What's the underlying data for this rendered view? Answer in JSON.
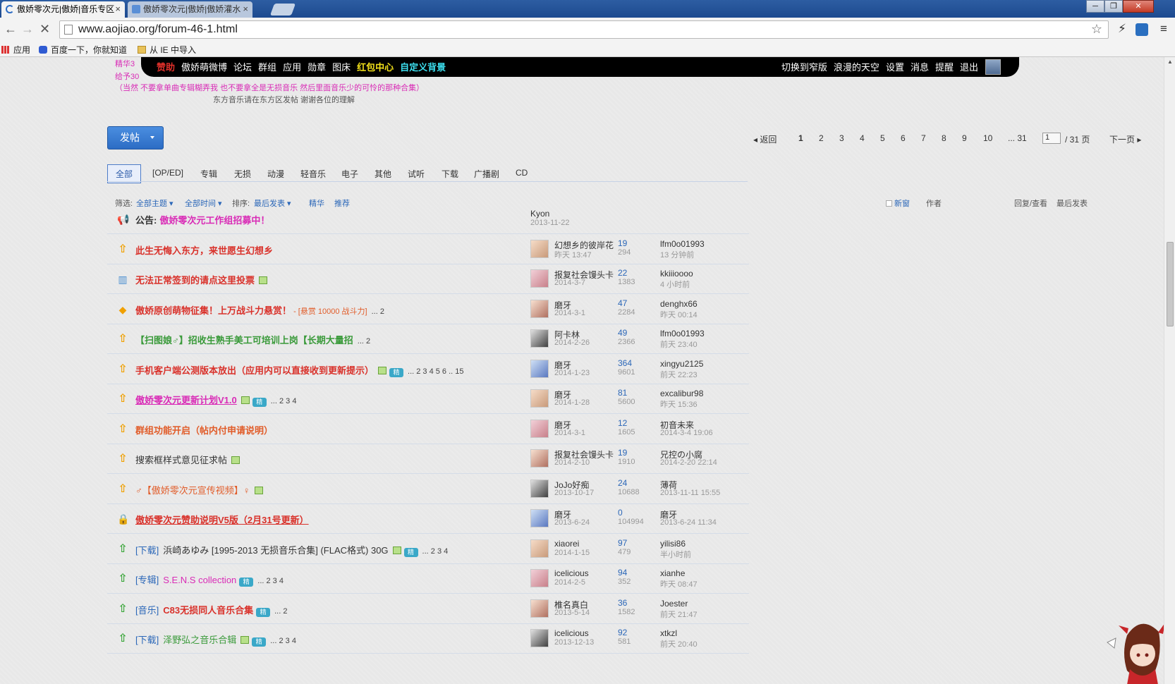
{
  "browser": {
    "tabs": [
      {
        "label": "傲娇零次元|傲娇|音乐专区"
      },
      {
        "label": "傲娇零次元|傲娇|傲娇灌水"
      }
    ],
    "url": "www.aojiao.org/forum-46-1.html",
    "window_controls": [
      "─",
      "❐",
      "✕"
    ],
    "bookmarks": [
      "应用",
      "百度一下，你就知道",
      "从 IE 中导入"
    ]
  },
  "topbar": {
    "left": [
      "赞助",
      "傲娇萌微博",
      "论坛",
      "群组",
      "应用",
      "勋章",
      "图床",
      "红包中心",
      "自定义背景"
    ],
    "right": [
      "切换到窄版",
      "浪漫的天空",
      "设置",
      "消息",
      "提醒",
      "退出"
    ]
  },
  "notices": {
    "line1": "精华3",
    "line2": "给予30",
    "line3": "（当然 不要拿单曲专辑糊弄我 也不要拿全是无损音乐 然后里面音乐少的可怜的那种合集）",
    "line4": "东方音乐请在东方区发帖 谢谢各位的理解"
  },
  "post_button": {
    "label": "发帖"
  },
  "pager": {
    "back": "返回",
    "pages": [
      "1",
      "2",
      "3",
      "4",
      "5",
      "6",
      "7",
      "8",
      "9",
      "10",
      "... 31"
    ],
    "current": "1",
    "input_value": "1",
    "total": "/ 31 页",
    "next": "下一页"
  },
  "type_tabs": [
    "全部",
    "[OP/ED]",
    "专辑",
    "无损",
    "动漫",
    "轻音乐",
    "电子",
    "其他",
    "试听",
    "下载",
    "广播剧",
    "CD"
  ],
  "filter": {
    "prefix": "筛选:",
    "all_topics": "全部主题",
    "all_time": "全部时间",
    "sort_label": "排序:",
    "sort_value": "最后发表",
    "digest": "精华",
    "recommend": "推荐",
    "new_window": "新窗",
    "author": "作者",
    "reply_view": "回复/查看",
    "last_post": "最后发表"
  },
  "threads": [
    {
      "icon": "announce",
      "prefix": "公告:",
      "title": "傲娇零次元工作组招募中！",
      "title_color": "#d92bb6",
      "author": "Kyon",
      "adate": "2013-11-22",
      "replies": "",
      "views": "",
      "last": "",
      "ldate": "",
      "avatar": false
    },
    {
      "icon": "sticky",
      "title": "此生无悔入东方，来世愿生幻想乡",
      "title_color": "#d9312a",
      "author": "幻想乡的彼岸花",
      "adate": "昨天 13:47",
      "replies": "19",
      "views": "294",
      "last": "lfm0o01993",
      "ldate": "13 分钟前"
    },
    {
      "icon": "poll",
      "title": "无法正常签到的请点这里投票",
      "title_color": "#d9312a",
      "badge": true,
      "author": "报复社会馒头卡",
      "adate": "2014-3-7",
      "replies": "22",
      "views": "1383",
      "last": "kkiiioooo",
      "ldate": "4 小时前"
    },
    {
      "icon": "reward",
      "title": "傲娇原创萌物征集！上万战斗力悬赏！",
      "title_color": "#d9312a",
      "extra": " - [悬赏 10000 战斗力]",
      "pages": "... 2",
      "author": "磨牙",
      "adate": "2014-3-1",
      "replies": "47",
      "views": "2284",
      "last": "denghx66",
      "ldate": "昨天 00:14"
    },
    {
      "icon": "sticky",
      "title": "【扫图娘♂】招收生熟手美工可培训上岗【长期大量招",
      "title_color": "#3a9a3a",
      "pages": "... 2",
      "author": "阿卡林",
      "adate": "2014-2-26",
      "replies": "49",
      "views": "2366",
      "last": "lfm0o01993",
      "ldate": "前天 23:40"
    },
    {
      "icon": "sticky",
      "title": "手机客户端公测版本放出（应用内可以直接收到更新提示）",
      "title_color": "#d9312a",
      "badge": true,
      "jing": true,
      "pages": "... 2  3  4  5  6 .. 15",
      "author": "磨牙",
      "adate": "2014-1-23",
      "replies": "364",
      "views": "9601",
      "last": "xingyu2125",
      "ldate": "前天 22:23"
    },
    {
      "icon": "sticky",
      "title": "傲娇零次元更新计划V1.0",
      "title_color": "#d92bb6",
      "underline": true,
      "badge": true,
      "jing": true,
      "pages": "... 2  3  4",
      "author": "磨牙",
      "adate": "2014-1-28",
      "replies": "81",
      "views": "5600",
      "last": "excalibur98",
      "ldate": "昨天 15:36"
    },
    {
      "icon": "sticky",
      "title": "群组功能开启（帖内付申请说明）",
      "title_color": "#e15c29",
      "author": "磨牙",
      "adate": "2014-3-1",
      "replies": "12",
      "views": "1605",
      "last": "初音未来",
      "ldate": "2014-3-4 19:06"
    },
    {
      "icon": "sticky",
      "title": "搜索框样式意见征求帖",
      "title_color": "#333333",
      "normal": true,
      "badge": true,
      "author": "报复社会馒头卡",
      "adate": "2014-2-10",
      "replies": "19",
      "views": "1910",
      "last": "兄控の小腐",
      "ldate": "2014-2-20 22:14"
    },
    {
      "icon": "sticky",
      "title": "♂【傲娇零次元宣传视频】♀",
      "title_color": "#e15c29",
      "normal": true,
      "badge": true,
      "author": "JoJo好痴",
      "adate": "2013-10-17",
      "replies": "24",
      "views": "10688",
      "last": "薄荷",
      "ldate": "2013-11-11 15:55"
    },
    {
      "icon": "lock",
      "title": "傲娇零次元赞助说明V5版（2月31号更新）",
      "title_color": "#d9312a",
      "underline": true,
      "author": "磨牙",
      "adate": "2013-6-24",
      "replies": "0",
      "views": "104994",
      "last": "磨牙",
      "ldate": "2013-6-24 11:34"
    },
    {
      "icon": "up",
      "tag": "[下载]",
      "title": "浜崎あゆみ [1995-2013 无损音乐合集] (FLAC格式) 30G",
      "title_color": "#333333",
      "normal": true,
      "badge": true,
      "jing": true,
      "pages": "... 2  3  4",
      "author": "xiaorei",
      "adate": "2014-1-15",
      "replies": "97",
      "views": "479",
      "last": "yilisi86",
      "ldate": "半小时前"
    },
    {
      "icon": "up",
      "tag": "[专辑]",
      "title": "S.E.N.S collection",
      "title_color": "#d92bb6",
      "normal": true,
      "jing": true,
      "pages": "... 2  3  4",
      "author": "icelicious",
      "adate": "2014-2-5",
      "replies": "94",
      "views": "352",
      "last": "xianhe",
      "ldate": "昨天 08:47"
    },
    {
      "icon": "up",
      "tag": "[音乐]",
      "title": "C83无损同人音乐合集",
      "title_color": "#d9312a",
      "jing": true,
      "pages": "... 2",
      "author": "椎名真白",
      "adate": "2013-5-14",
      "replies": "36",
      "views": "1582",
      "last": "Joester",
      "ldate": "前天 21:47"
    },
    {
      "icon": "up",
      "tag": "[下载]",
      "title": "泽野弘之音乐合辑",
      "title_color": "#3a9a3a",
      "normal": true,
      "badge": true,
      "jing": true,
      "pages": "... 2  3  4",
      "author": "icelicious",
      "adate": "2013-12-13",
      "replies": "92",
      "views": "581",
      "last": "xtkzl",
      "ldate": "前天 20:40"
    }
  ]
}
